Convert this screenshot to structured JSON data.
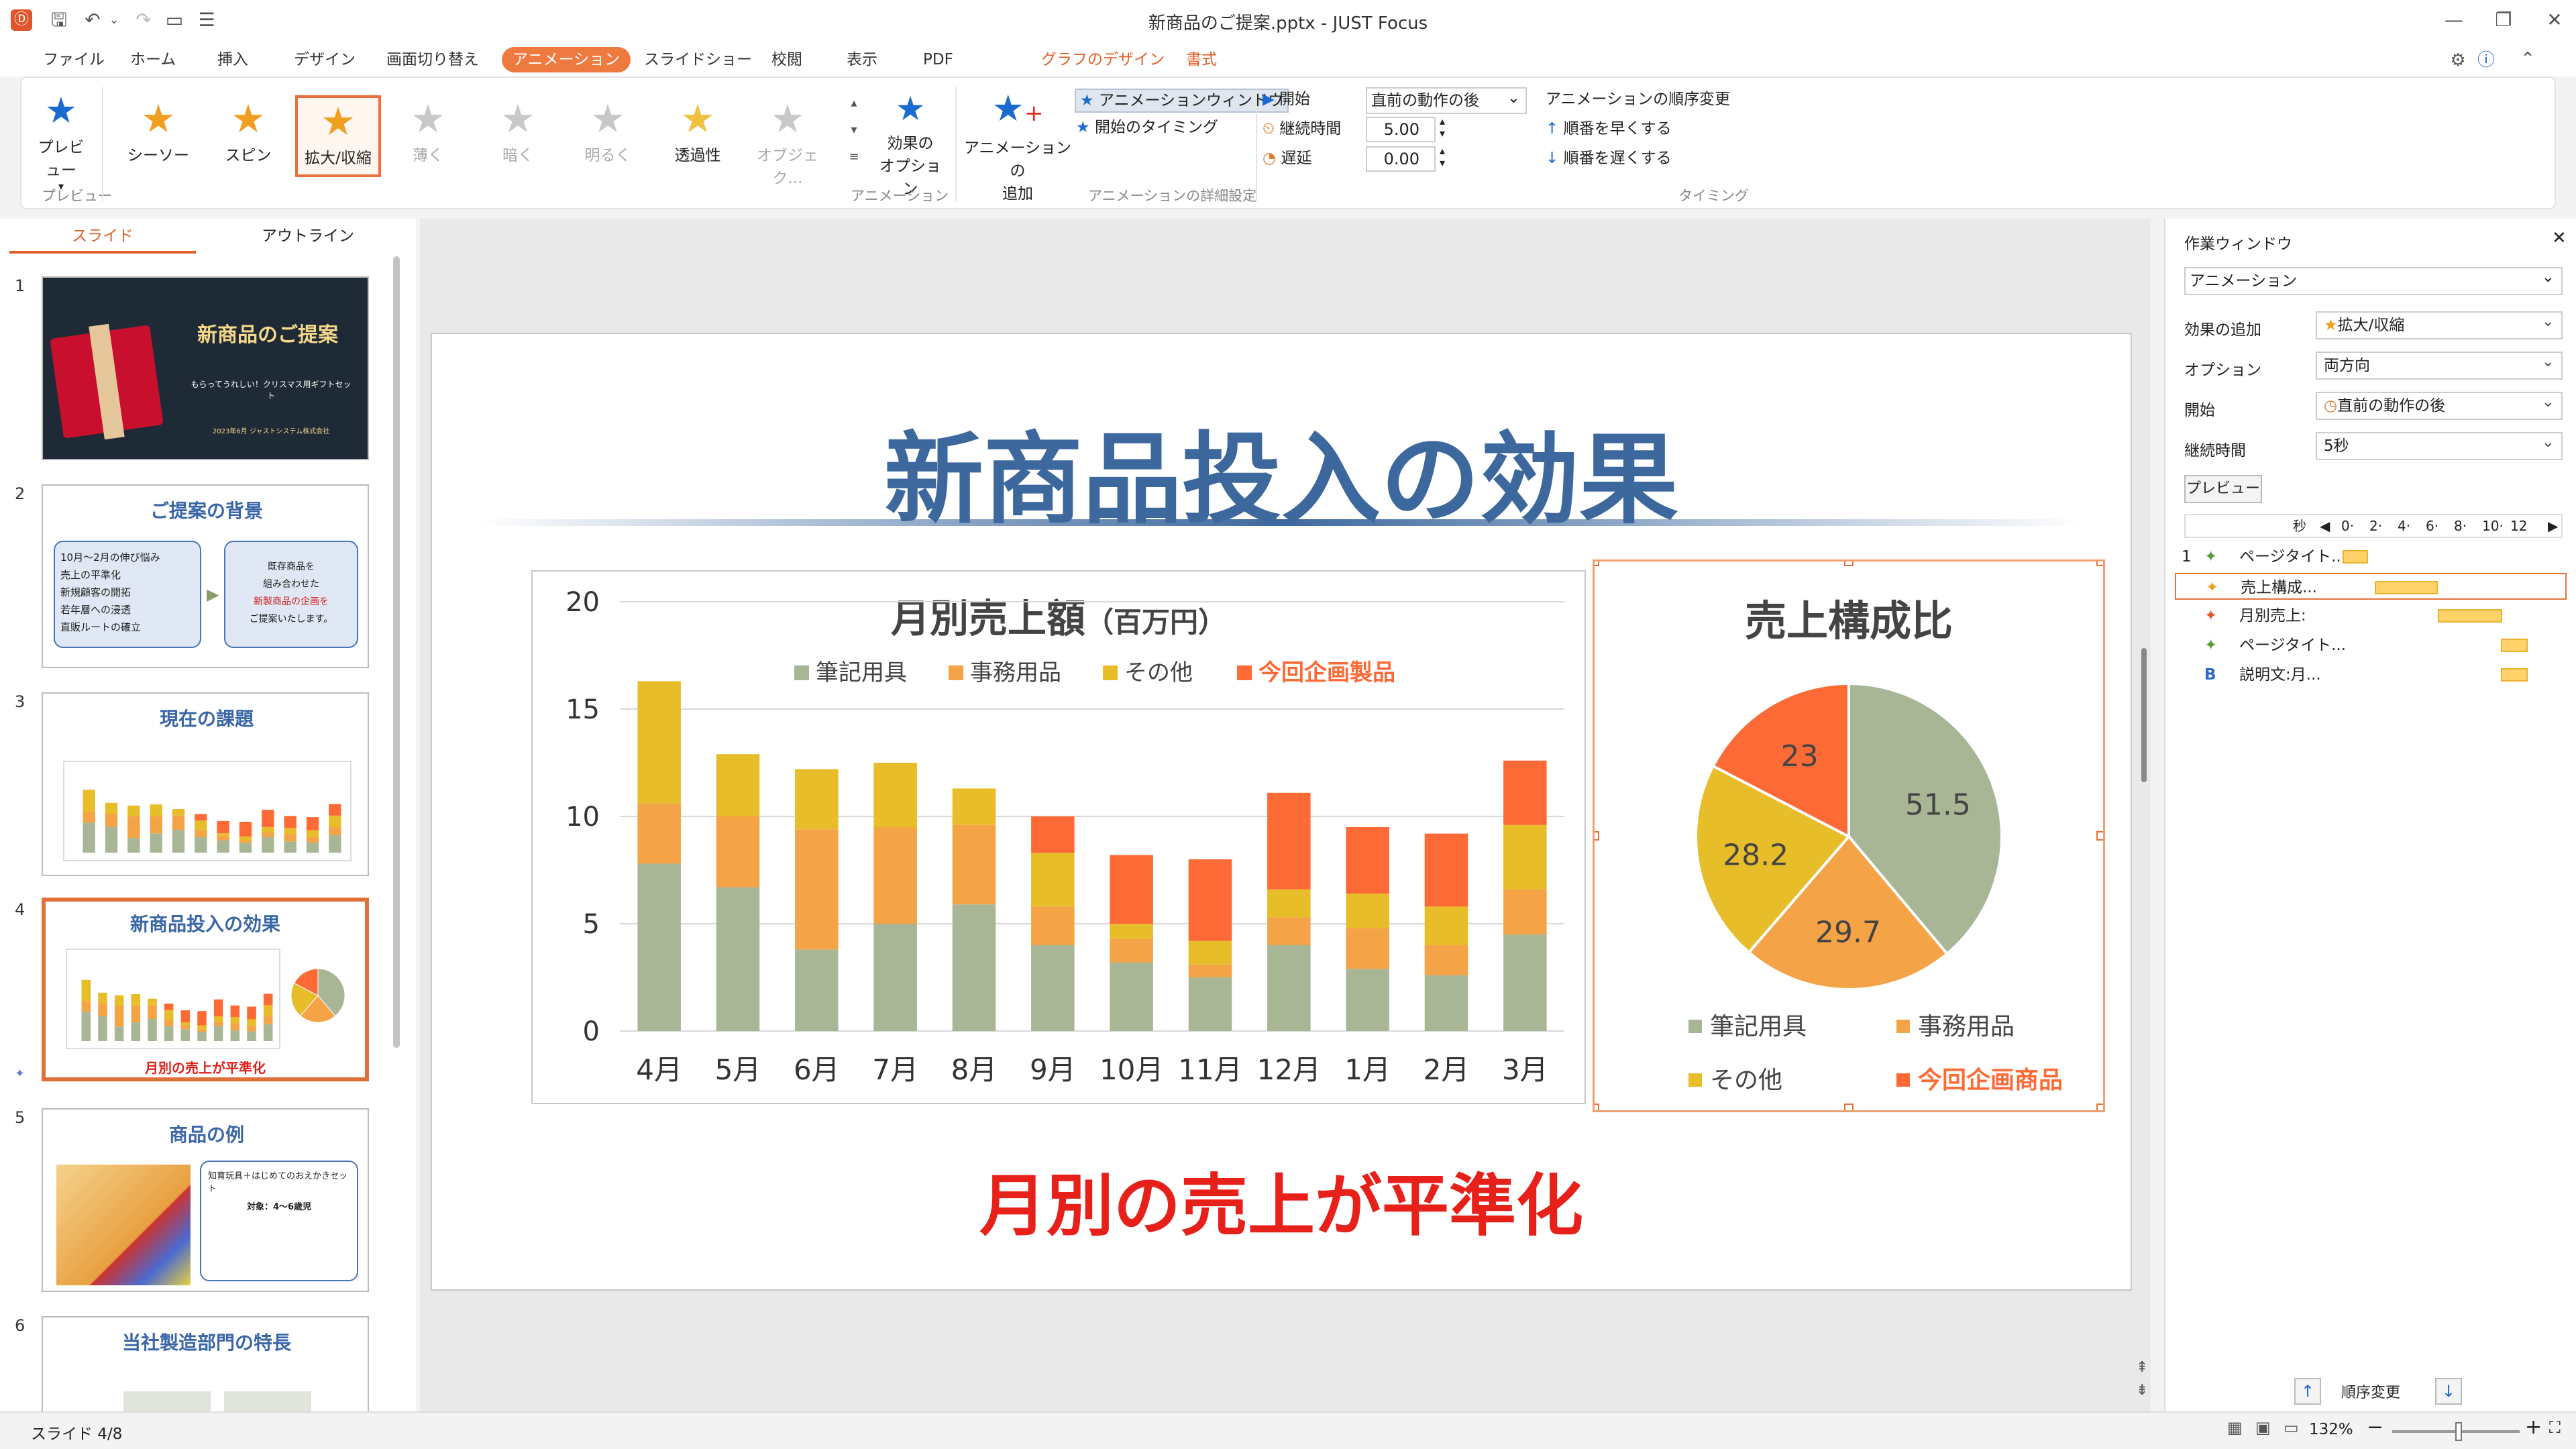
{
  "window": {
    "title": "新商品のご提案.pptx - JUST Focus"
  },
  "menu": {
    "items": [
      "ファイル",
      "ホーム",
      "挿入",
      "デザイン",
      "画面切り替え",
      "アニメーション",
      "スライドショー",
      "校閲",
      "表示",
      "PDF"
    ],
    "context_tabs": [
      "グラフのデザイン",
      "書式"
    ],
    "active": "アニメーション"
  },
  "ribbon": {
    "preview": "プレビュー",
    "preview_group": "プレビュー",
    "animations": [
      {
        "label": "シーソー",
        "color": "#f0a020",
        "enabled": true
      },
      {
        "label": "スピン",
        "color": "#f0a020",
        "enabled": true
      },
      {
        "label": "拡大/収縮",
        "color": "#f0a020",
        "enabled": true,
        "selected": true
      },
      {
        "label": "薄く",
        "color": "#c8c8c8",
        "enabled": false
      },
      {
        "label": "暗く",
        "color": "#c8c8c8",
        "enabled": false
      },
      {
        "label": "明るく",
        "color": "#c8c8c8",
        "enabled": false
      },
      {
        "label": "透過性",
        "color": "#f0c040",
        "enabled": true
      },
      {
        "label": "オブジェク...",
        "color": "#c8c8c8",
        "enabled": false
      }
    ],
    "effect_options": [
      "効果の",
      "オプション"
    ],
    "animation_group": "アニメーション",
    "add_animation": [
      "アニメーションの",
      "追加"
    ],
    "anim_window": "アニメーションウィンドウ",
    "start_timing": "開始のタイミング",
    "detail_group": "アニメーションの詳細設定",
    "start_label": "開始",
    "start_value": "直前の動作の後",
    "duration_label": "継続時間",
    "duration_value": "5.00",
    "delay_label": "遅延",
    "delay_value": "0.00",
    "reorder_title": "アニメーションの順序変更",
    "move_earlier": "順番を早くする",
    "move_later": "順番を遅くする",
    "timing_group": "タイミング"
  },
  "slide_panel": {
    "tabs": [
      "スライド",
      "アウトライン"
    ],
    "active_tab": "スライド",
    "thumbs": [
      {
        "num": "1",
        "title": "新商品のご提案",
        "sub": "もらってうれしい！クリスマス用ギフトセット",
        "foot": "2023年6月 ジャストシステム株式会社"
      },
      {
        "num": "2",
        "title": "ご提案の背景",
        "bullets": [
          "10月～2月の伸び悩み",
          "売上の平準化",
          "新規顧客の開拓",
          "若年層への浸透",
          "直販ルートの確立"
        ],
        "right": [
          "既存商品を",
          "組み合わせた",
          "新製商品の企画を",
          "ご提案いたします。"
        ]
      },
      {
        "num": "3",
        "title": "現在の課題"
      },
      {
        "num": "4",
        "title": "新商品投入の効果",
        "caption": "月別の売上が平準化"
      },
      {
        "num": "5",
        "title": "商品の例",
        "sub": "知育玩具＋はじめてのおえかきセット",
        "target": "対象：4～6歳児"
      },
      {
        "num": "6",
        "title": "当社製造部門の特長"
      }
    ]
  },
  "slide": {
    "title": "新商品投入の効果",
    "caption": "月別の売上が平準化"
  },
  "chart_data": [
    {
      "type": "bar",
      "stacked": true,
      "title": "月別売上額",
      "title_unit": "（百万円）",
      "categories": [
        "4月",
        "5月",
        "6月",
        "7月",
        "8月",
        "9月",
        "10月",
        "11月",
        "12月",
        "1月",
        "2月",
        "3月"
      ],
      "ylim": [
        0,
        20
      ],
      "yticks": [
        0,
        5,
        10,
        15,
        20
      ],
      "grid": true,
      "legend": "top",
      "series": [
        {
          "name": "筆記用具",
          "color": "#a9b695",
          "values": [
            7.8,
            6.7,
            3.8,
            5.0,
            5.9,
            4.0,
            3.2,
            2.5,
            4.0,
            2.9,
            2.6,
            4.5
          ]
        },
        {
          "name": "事務用品",
          "color": "#f4a446",
          "values": [
            2.8,
            3.3,
            5.6,
            4.5,
            3.7,
            1.8,
            1.1,
            0.6,
            1.3,
            1.9,
            1.4,
            2.1
          ]
        },
        {
          "name": "その他",
          "color": "#e8bd2a",
          "values": [
            5.7,
            2.9,
            2.8,
            3.0,
            1.7,
            2.5,
            0.7,
            1.1,
            1.3,
            1.6,
            1.8,
            3.0
          ]
        },
        {
          "name": "今回企画製品",
          "color": "#fe6a35",
          "values": [
            0,
            0,
            0,
            0,
            0,
            1.7,
            3.2,
            3.8,
            4.5,
            3.1,
            3.4,
            3.0
          ]
        }
      ]
    },
    {
      "type": "pie",
      "title": "売上構成比",
      "series": [
        {
          "name": "筆記用具",
          "color": "#a9b695",
          "value": 51.5
        },
        {
          "name": "事務用品",
          "color": "#f4a446",
          "value": 29.7
        },
        {
          "name": "その他",
          "color": "#e8bd2a",
          "value": 28.2
        },
        {
          "name": "今回企画商品",
          "color": "#fe6a35",
          "value": 23
        }
      ]
    }
  ],
  "taskpane": {
    "title": "作業ウィンドウ",
    "panel": "アニメーション",
    "add_effect_label": "効果の追加",
    "add_effect_value": "拡大/収縮",
    "option_label": "オプション",
    "option_value": "両方向",
    "start_label": "開始",
    "start_value": "直前の動作の後",
    "duration_label": "継続時間",
    "duration_value": "5秒",
    "preview_button": "プレビュー",
    "timeline_unit": "秒",
    "timeline_ticks": [
      "0",
      "2",
      "4",
      "6",
      "8",
      "10",
      "12"
    ],
    "items": [
      {
        "num": "1",
        "label": "ページタイト...",
        "icon_color": "#5a9a3a"
      },
      {
        "num": "",
        "label": "売上構成...",
        "icon_color": "#f0a020",
        "selected": true
      },
      {
        "num": "",
        "label": "月別売上:",
        "icon_color": "#e05a2a"
      },
      {
        "num": "",
        "label": "ページタイト...",
        "icon_color": "#5a9a3a"
      },
      {
        "num": "",
        "label": "説明文:月...",
        "icon_color": "#2a6ad0",
        "icon_text": "B"
      }
    ],
    "reorder": "順序変更"
  },
  "status": {
    "slide": "スライド 4/8",
    "zoom": "132%"
  }
}
